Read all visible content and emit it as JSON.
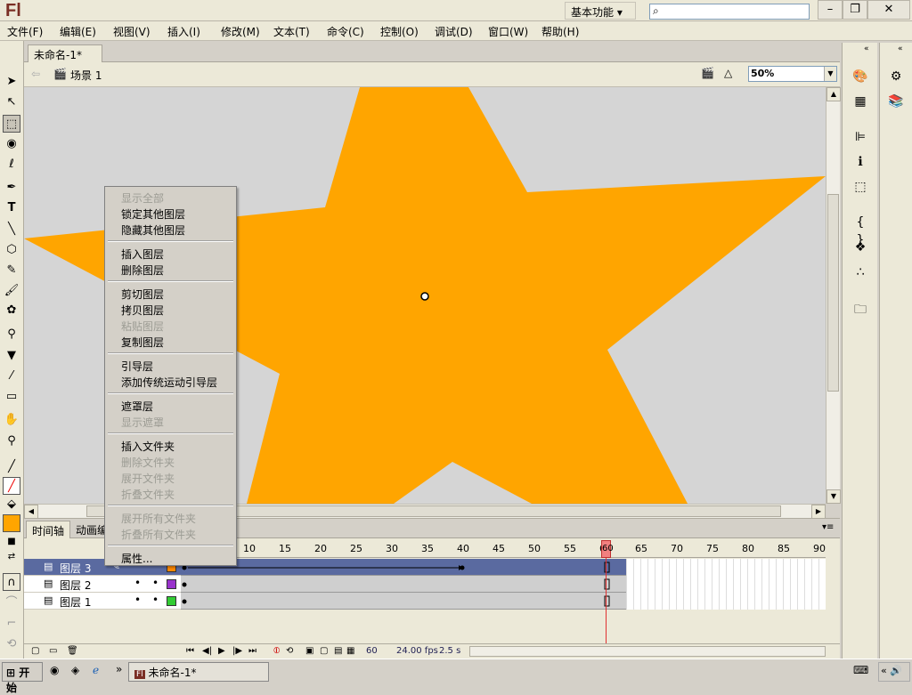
{
  "app": {
    "logo": "Fl",
    "workspace": "基本功能 ▾",
    "search_placeholder": ""
  },
  "menu": [
    "文件(F)",
    "编辑(E)",
    "视图(V)",
    "插入(I)",
    "修改(M)",
    "文本(T)",
    "命令(C)",
    "控制(O)",
    "调试(D)",
    "窗口(W)",
    "帮助(H)"
  ],
  "doc": {
    "tab": "未命名-1*",
    "scene": "场景 1",
    "zoom": "50%"
  },
  "stage": {
    "shape_color": "#ffa500",
    "background": "#d5d5d5"
  },
  "timeline": {
    "tabs": [
      "时间轴",
      "动画编"
    ],
    "ruler": [
      "10",
      "15",
      "20",
      "25",
      "30",
      "35",
      "40",
      "45",
      "50",
      "55",
      "60",
      "65",
      "70",
      "75",
      "80",
      "85",
      "90"
    ],
    "layers": [
      {
        "name": "图层 3",
        "color": "#ff8800"
      },
      {
        "name": "图层 2",
        "color": "#9933cc"
      },
      {
        "name": "图层 1",
        "color": "#33cc33"
      }
    ],
    "current_frame": "60",
    "footer": {
      "frame": "60",
      "fps": "24.00 fps",
      "time": "2.5 s"
    }
  },
  "context_menu": [
    {
      "label": "显示全部",
      "disabled": true
    },
    {
      "label": "锁定其他图层",
      "disabled": false
    },
    {
      "label": "隐藏其他图层",
      "disabled": false
    },
    {
      "label": "插入图层",
      "disabled": false
    },
    {
      "label": "删除图层",
      "disabled": false
    },
    {
      "label": "剪切图层",
      "disabled": false
    },
    {
      "label": "拷贝图层",
      "disabled": false
    },
    {
      "label": "粘贴图层",
      "disabled": true
    },
    {
      "label": "复制图层",
      "disabled": false
    },
    {
      "label": "引导层",
      "disabled": false
    },
    {
      "label": "添加传统运动引导层",
      "disabled": false
    },
    {
      "label": "遮罩层",
      "disabled": false
    },
    {
      "label": "显示遮罩",
      "disabled": true
    },
    {
      "label": "插入文件夹",
      "disabled": false
    },
    {
      "label": "删除文件夹",
      "disabled": true
    },
    {
      "label": "展开文件夹",
      "disabled": true
    },
    {
      "label": "折叠文件夹",
      "disabled": true
    },
    {
      "label": "展开所有文件夹",
      "disabled": true
    },
    {
      "label": "折叠所有文件夹",
      "disabled": true
    },
    {
      "label": "属性...",
      "disabled": false
    }
  ],
  "taskbar": {
    "start": "开始",
    "task": "未命名-1*"
  }
}
